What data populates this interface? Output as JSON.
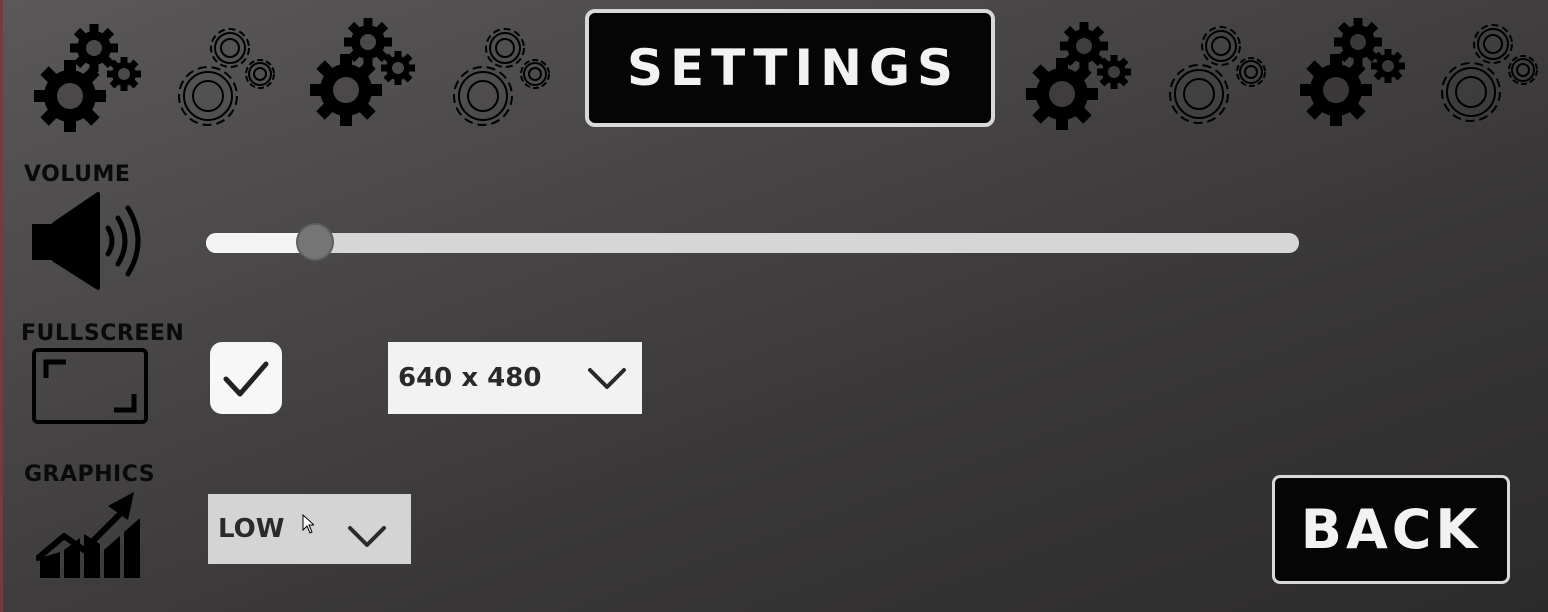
{
  "title": "SETTINGS",
  "volume": {
    "label": "VOLUME",
    "icon": "speaker-icon",
    "value": 0.1
  },
  "fullscreen": {
    "label": "FULLSCREEN",
    "icon": "fullscreen-icon",
    "checked": true,
    "resolution": "640 x 480"
  },
  "graphics": {
    "label": "GRAPHICS",
    "icon": "chart-growth-icon",
    "quality": "LOW"
  },
  "back_label": "BACK",
  "colors": {
    "banner_bg": "#050505",
    "banner_border": "#d8d8d8",
    "label_text": "#0a0a0a",
    "slider_track": "#d6d6d6",
    "slider_knob": "#757575"
  }
}
